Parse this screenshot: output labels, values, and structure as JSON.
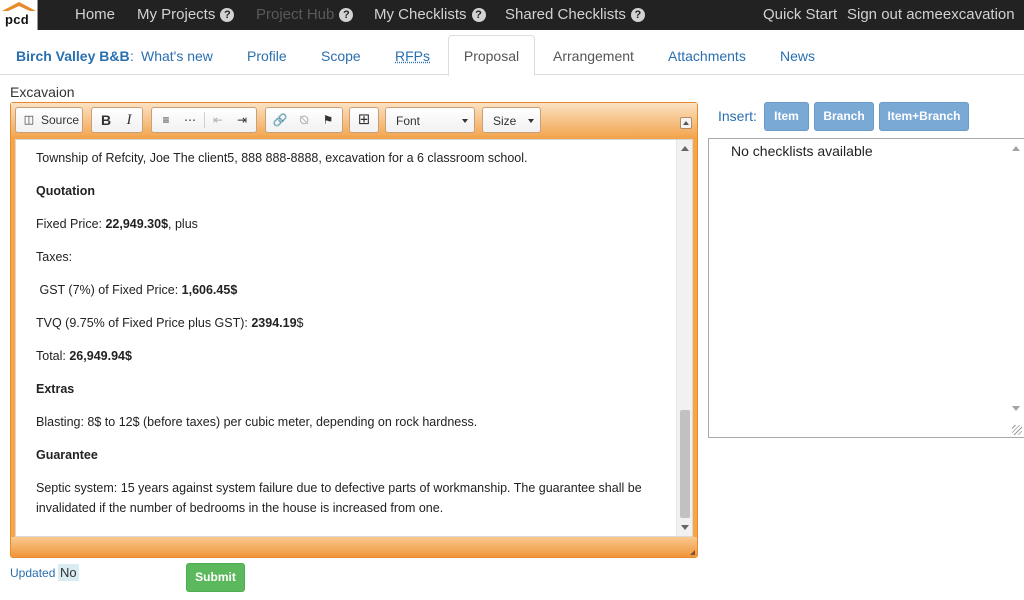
{
  "topnav": {
    "logo_text": "pcd",
    "links": [
      {
        "label": "Home"
      },
      {
        "label": "My Projects",
        "help": "?"
      },
      {
        "label": "Project Hub",
        "help": "?",
        "disabled": true
      },
      {
        "label": "My Checklists",
        "help": "?"
      },
      {
        "label": "Shared Checklists",
        "help": "?"
      }
    ],
    "quick_start": "Quick Start",
    "sign_out": "Sign out acmeexcavation"
  },
  "subnav": {
    "brand": "Birch Valley B&B",
    "brand_colon": ":",
    "tabs": [
      {
        "label": "What's new"
      },
      {
        "label": "Profile"
      },
      {
        "label": "Scope"
      },
      {
        "label": "RFPs"
      },
      {
        "label": "Proposal",
        "active": true
      },
      {
        "label": "Arrangement"
      },
      {
        "label": "Attachments"
      },
      {
        "label": "News"
      }
    ]
  },
  "editor": {
    "field_label": "Excavaion",
    "toolbar": {
      "source": "Source",
      "bold": "B",
      "italic": "I",
      "font": "Font",
      "size": "Size"
    },
    "content": {
      "intro": "Township of Refcity, Joe The client5, 888 888-8888, excavation for a 6 classroom school.",
      "quotation_heading": "Quotation",
      "fixed_price_label": "Fixed Price: ",
      "fixed_price_value": "22,949.30$",
      "fixed_price_suffix": ", plus",
      "taxes_label": "Taxes:",
      "gst_label": " GST (7%) of Fixed Price: ",
      "gst_value": "1,606.45$",
      "tvq_label": "TVQ (9.75% of Fixed Price plus GST): ",
      "tvq_value": "2394.19",
      "tvq_suffix": "$",
      "total_label": "Total: ",
      "total_value": "26,949.94$",
      "extras_heading": "Extras",
      "blasting": "Blasting: 8$ to 12$ (before taxes) per cubic meter, depending on rock hardness.",
      "guarantee_heading": "Guarantee",
      "septic": "Septic system: 15 years against system failure due to defective parts of workmanship. The guarantee shall be invalidated if the number of bedrooms in the house is increased from one."
    }
  },
  "footer": {
    "updated_label": "Updated",
    "updated_value": "No",
    "submit_label": "Submit"
  },
  "insert_panel": {
    "label": "Insert:",
    "buttons": [
      "Item",
      "Branch",
      "Item+Branch"
    ],
    "empty_text": "No checklists available"
  }
}
